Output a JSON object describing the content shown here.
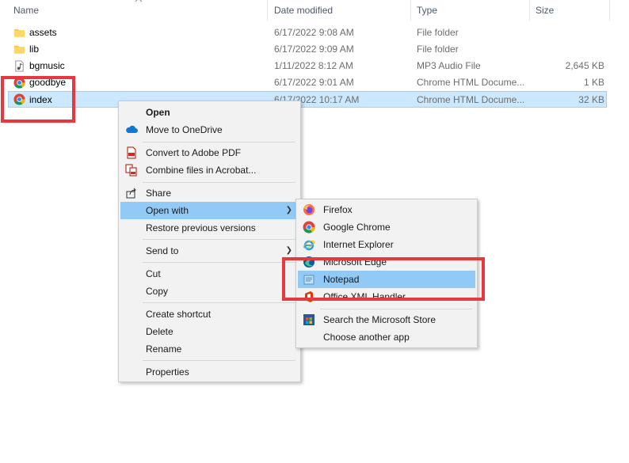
{
  "columns": {
    "name": "Name",
    "date": "Date modified",
    "type": "Type",
    "size": "Size"
  },
  "files": [
    {
      "name": "assets",
      "date": "6/17/2022 9:08 AM",
      "type": "File folder",
      "size": "",
      "icon": "folder-icon"
    },
    {
      "name": "lib",
      "date": "6/17/2022 9:09 AM",
      "type": "File folder",
      "size": "",
      "icon": "folder-icon"
    },
    {
      "name": "bgmusic",
      "date": "1/11/2022 8:12 AM",
      "type": "MP3 Audio File",
      "size": "2,645 KB",
      "icon": "audio-file-icon"
    },
    {
      "name": "goodbye",
      "date": "6/17/2022 9:01 AM",
      "type": "Chrome HTML Docume...",
      "size": "1 KB",
      "icon": "chrome-icon"
    },
    {
      "name": "index",
      "date": "6/17/2022 10:17 AM",
      "type": "Chrome HTML Docume...",
      "size": "32 KB",
      "icon": "chrome-icon"
    }
  ],
  "context_menu": {
    "open": "Open",
    "move_onedrive": "Move to OneDrive",
    "convert_pdf": "Convert to Adobe PDF",
    "combine_acrobat": "Combine files in Acrobat...",
    "share": "Share",
    "open_with": "Open with",
    "restore": "Restore previous versions",
    "send_to": "Send to",
    "cut": "Cut",
    "copy": "Copy",
    "create_shortcut": "Create shortcut",
    "delete": "Delete",
    "rename": "Rename",
    "properties": "Properties"
  },
  "open_with_menu": {
    "firefox": "Firefox",
    "chrome": "Google Chrome",
    "ie": "Internet Explorer",
    "edge": "Microsoft Edge",
    "notepad": "Notepad",
    "office_xml": "Office XML Handler",
    "store": "Search the Microsoft Store",
    "another": "Choose another app"
  },
  "colors": {
    "selection": "#cce8ff",
    "menu_highlight": "#91c9f7",
    "annotation_red": "#e8383f"
  }
}
